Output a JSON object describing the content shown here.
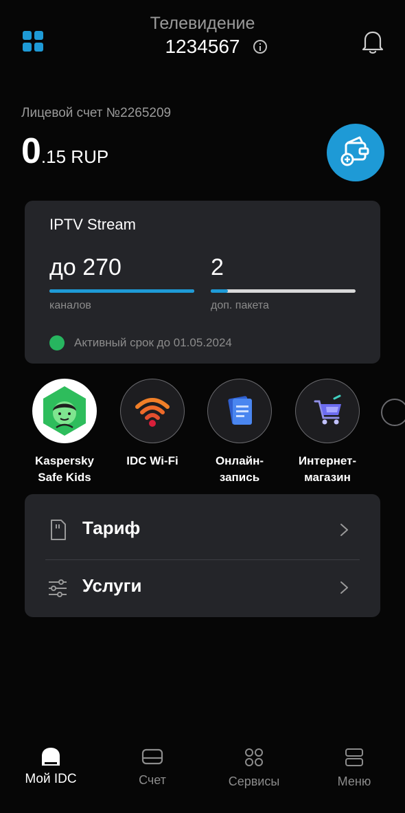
{
  "header": {
    "title": "Телевидение",
    "number": "1234567"
  },
  "account": {
    "label": "Лицевой счет №2265209",
    "balance_int": "0",
    "balance_dec": ".15 RUP"
  },
  "iptv": {
    "title": "IPTV Stream",
    "channels_value": "до 270",
    "channels_label": "каналов",
    "channels_progress": 1.0,
    "packages_value": "2",
    "packages_label": "доп. пакета",
    "packages_progress": 0.12,
    "status_text": "Активный срок до 01.05.2024"
  },
  "services": [
    {
      "label": "Kaspersky\nSafe Kids",
      "icon": "kaspersky-kids-icon"
    },
    {
      "label": "IDC Wi-Fi",
      "icon": "wifi-icon"
    },
    {
      "label": "Онлайн-\nзапись",
      "icon": "document-icon"
    },
    {
      "label": "Интернет-\nмагазин",
      "icon": "shopping-cart-icon"
    }
  ],
  "menu": {
    "tariff_label": "Тариф",
    "services_label": "Услуги"
  },
  "nav": {
    "home": "Мой IDC",
    "account": "Счет",
    "services": "Сервисы",
    "menu": "Меню"
  },
  "colors": {
    "accent": "#1e9ad6",
    "background": "#060606",
    "card": "#242529",
    "status_green": "#27b55f"
  }
}
